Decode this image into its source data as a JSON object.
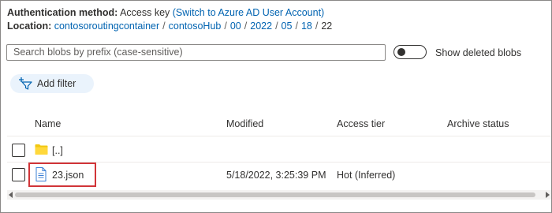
{
  "auth": {
    "label": "Authentication method:",
    "value": "Access key",
    "switch_link": "(Switch to Azure AD User Account)"
  },
  "location": {
    "label": "Location:",
    "crumbs": [
      "contosoroutingcontainer",
      "contosoHub",
      "00",
      "2022",
      "05",
      "18"
    ],
    "current": "22",
    "separator": "/"
  },
  "search": {
    "placeholder": "Search blobs by prefix (case-sensitive)"
  },
  "toggle": {
    "label": "Show deleted blobs",
    "state": "off"
  },
  "filter": {
    "add_label": "Add filter"
  },
  "table": {
    "columns": [
      "Name",
      "Modified",
      "Access tier",
      "Archive status"
    ],
    "rows": [
      {
        "name": "[..]",
        "icon": "folder-icon",
        "modified": "",
        "tier": "",
        "archive": ""
      },
      {
        "name": "23.json",
        "icon": "file-icon",
        "modified": "5/18/2022, 3:25:39 PM",
        "tier": "Hot (Inferred)",
        "archive": ""
      }
    ]
  },
  "colors": {
    "link": "#0063b1",
    "highlight": "#d13438",
    "folder": "#f2c811",
    "filter_bg": "#eaf3fc"
  }
}
